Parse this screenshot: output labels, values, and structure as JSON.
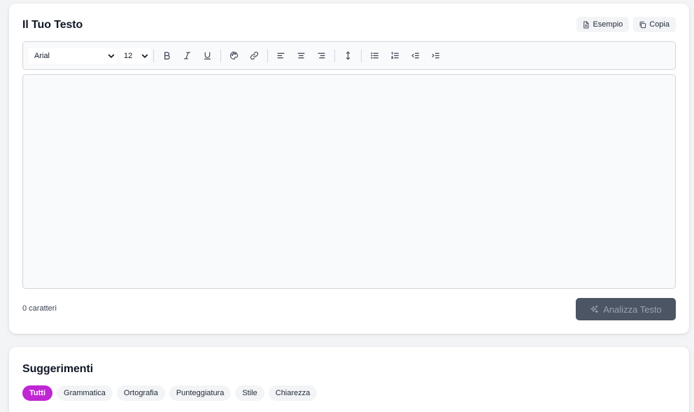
{
  "editor": {
    "title": "Il Tuo Testo",
    "example_label": "Esempio",
    "copy_label": "Copia",
    "font_family": "Arial",
    "font_size": "12",
    "char_count": "0 caratteri",
    "analyze_label": "Analizza Testo",
    "toolbar_icons": [
      "bold-icon",
      "italic-icon",
      "underline-icon",
      "palette-icon",
      "link-icon",
      "align-left-icon",
      "align-center-icon",
      "align-right-icon",
      "line-height-icon",
      "bullet-list-icon",
      "numbered-list-icon",
      "outdent-icon",
      "indent-icon"
    ]
  },
  "suggestions": {
    "title": "Suggerimenti",
    "filters": [
      "Tutti",
      "Grammatica",
      "Ortografia",
      "Punteggiatura",
      "Stile",
      "Chiarezza"
    ],
    "active_filter": "Tutti"
  },
  "colors": {
    "accent": "#c026d3",
    "analyze_button": "#4b5563"
  }
}
